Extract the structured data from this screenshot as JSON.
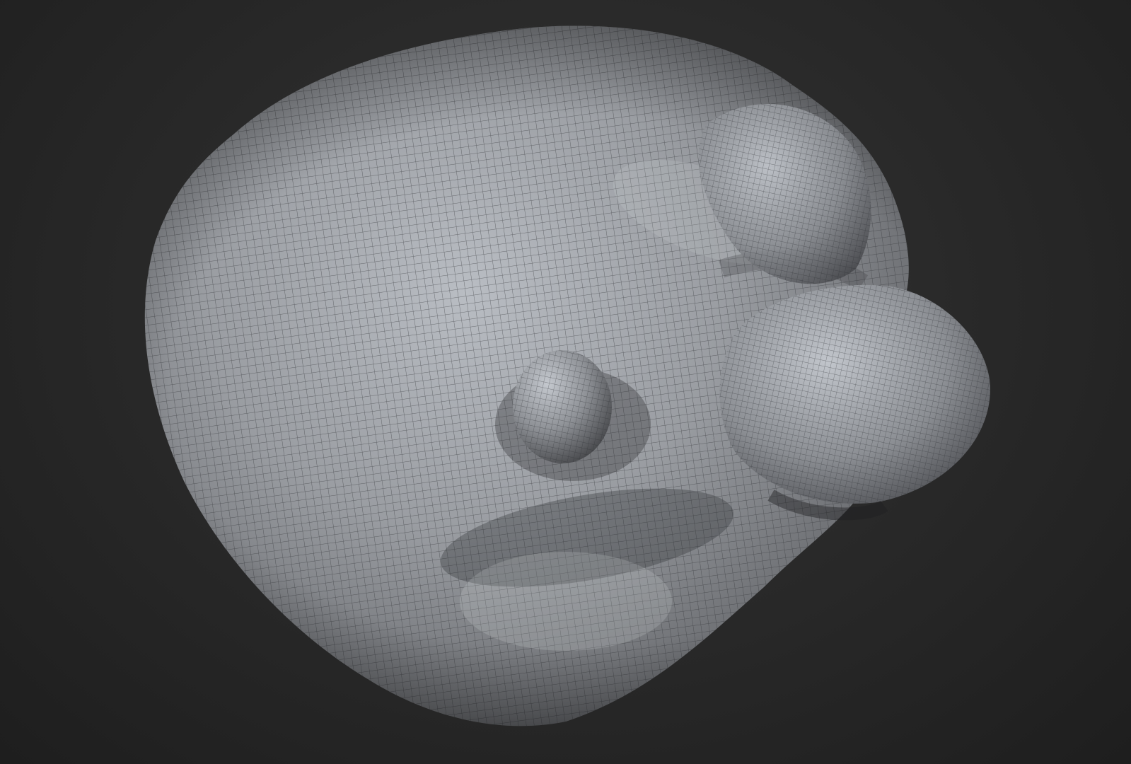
{
  "scene": {
    "object": "sculpted-mesh",
    "shading": "matcap-gray-wireframe",
    "colors": {
      "background_center": "#3a3a3a",
      "background_edge": "#1e1e1e",
      "mesh_light": "#b8bcc2",
      "mesh_mid": "#8a8d92",
      "mesh_dark": "#3c3d40",
      "wire": "#2e2f33"
    }
  }
}
